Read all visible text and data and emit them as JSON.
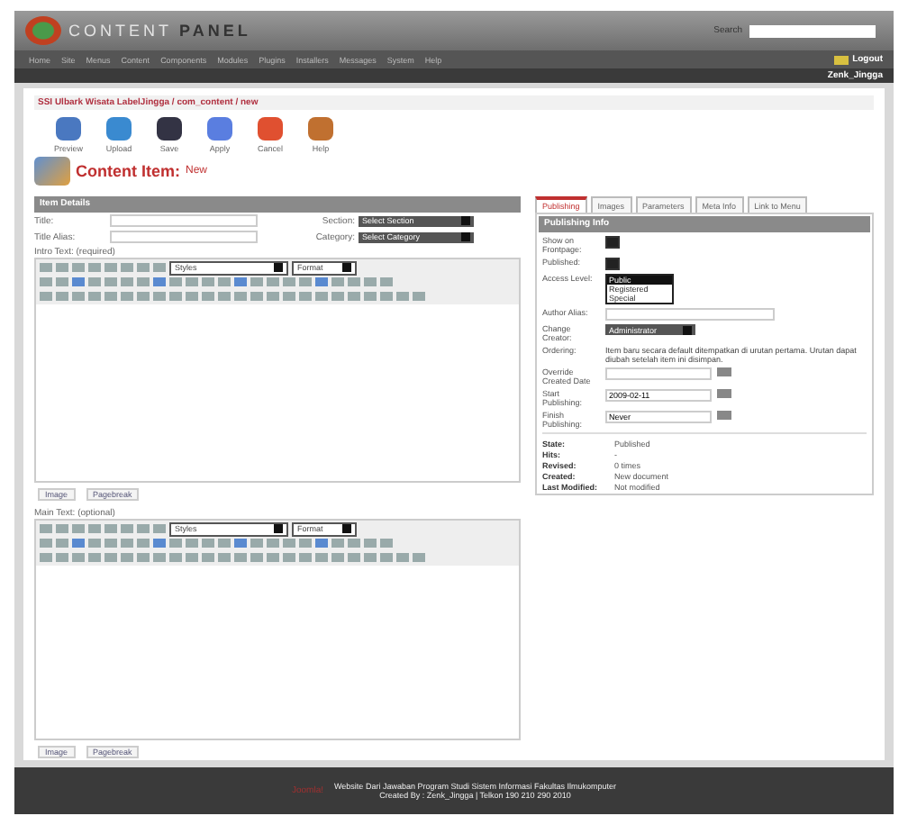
{
  "header": {
    "logo_dim": "CONTENT",
    "logo": "PANEL",
    "search_label": "Search"
  },
  "menu": [
    {
      "label": "Home"
    },
    {
      "label": "Site"
    },
    {
      "label": "Menus"
    },
    {
      "label": "Content"
    },
    {
      "label": "Components"
    },
    {
      "label": "Modules"
    },
    {
      "label": "Plugins"
    },
    {
      "label": "Installers"
    },
    {
      "label": "Messages"
    },
    {
      "label": "System"
    },
    {
      "label": "Help"
    }
  ],
  "logout": "Logout",
  "user": "Zenk_Jingga",
  "breadcrumb": "SSI Ulbark Wisata LabelJingga / com_content / new",
  "toolbar": [
    {
      "kind": "preview",
      "label": "Preview"
    },
    {
      "kind": "upload",
      "label": "Upload"
    },
    {
      "kind": "save",
      "label": "Save"
    },
    {
      "kind": "apply",
      "label": "Apply"
    },
    {
      "kind": "cancel",
      "label": "Cancel"
    },
    {
      "kind": "help",
      "label": "Help"
    }
  ],
  "page_title": "Content Item:",
  "page_subtitle": "New",
  "details": {
    "title": "Item Details",
    "title_label": "Title:",
    "alias_label": "Title Alias:",
    "section_label": "Section:",
    "section_value": "Select Section",
    "category_label": "Category:",
    "category_value": "Select Category"
  },
  "editors": [
    {
      "label": "Intro Text: (required)",
      "styles": "Styles",
      "format": "Format",
      "image_button": "Image",
      "pagebreak_button": "Pagebreak"
    },
    {
      "label": "Main Text: (optional)",
      "styles": "Styles",
      "format": "Format",
      "image_button": "Image",
      "pagebreak_button": "Pagebreak"
    }
  ],
  "tabs": [
    {
      "label": "Publishing",
      "selected": true
    },
    {
      "label": "Images",
      "selected": false
    },
    {
      "label": "Parameters",
      "selected": false
    },
    {
      "label": "Meta Info",
      "selected": false
    },
    {
      "label": "Link to Menu",
      "selected": false
    }
  ],
  "publishing": {
    "title": "Publishing Info",
    "frontpage_label": "Show on Frontpage:",
    "frontpage_checked": true,
    "published_label": "Published:",
    "published_checked": true,
    "access_label": "Access Level:",
    "access_options": [
      {
        "label": "Public",
        "selected": true
      },
      {
        "label": "Registered",
        "selected": false
      },
      {
        "label": "Special",
        "selected": false
      }
    ],
    "author_alias_label": "Author Alias:",
    "creator_label": "Change Creator:",
    "creator_value": "Administrator",
    "ordering_label": "Ordering:",
    "ordering_text": "Item baru secara default ditempatkan di urutan pertama. Urutan dapat diubah setelah item ini disimpan.",
    "created_label": "Override Created Date",
    "start_label": "Start Publishing:",
    "start_value": "2009-02-11",
    "finish_label": "Finish Publishing:",
    "finish_value": "Never"
  },
  "info": [
    {
      "label": "State:",
      "value": "Published"
    },
    {
      "label": "Hits:",
      "value": "-"
    },
    {
      "label": "Revised:",
      "value": "0 times"
    },
    {
      "label": "Created:",
      "value": "New document"
    },
    {
      "label": "Last Modified:",
      "value": "Not modified"
    }
  ],
  "footer": {
    "brand": "Joomla!",
    "line1": "Website Dari Jawaban Program Studi Sistem Informasi Fakultas Ilmukomputer",
    "line2": "Created By : Zenk_Jingga | Telkon 190 210 290 2010"
  }
}
